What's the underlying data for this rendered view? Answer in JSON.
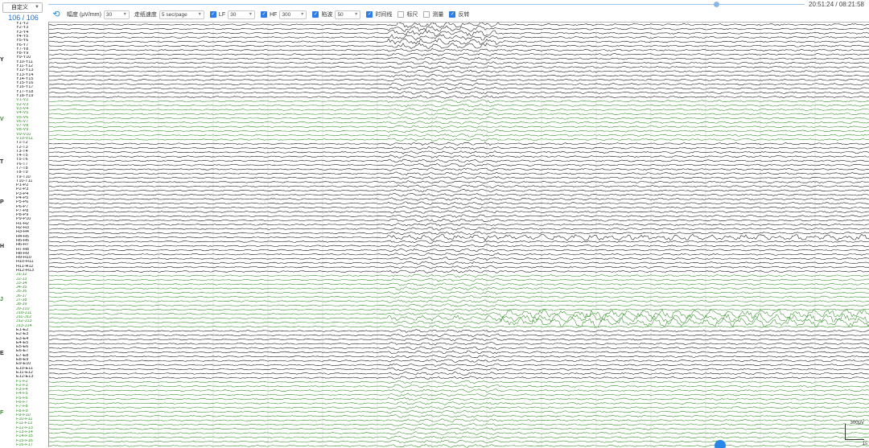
{
  "montage": {
    "value": "自定义"
  },
  "channel_count": "106 / 106",
  "time_readout": "20:51:24 / 08:21:58",
  "playback_position": 0.883,
  "toolbar": {
    "amplitude_label": "幅度 (μV/mm)",
    "amplitude_value": "30",
    "speed_label": "走纸速度",
    "speed_value": "5 sec/page",
    "lf_label": "LF",
    "lf_value": "30",
    "hf_label": "HF",
    "hf_value": "300",
    "notch_label": "陷波",
    "notch_value": "50",
    "timeline_label": "时间线",
    "ruler_label": "标尺",
    "measure_label": "测量",
    "invert_label": "反转"
  },
  "checkboxes": {
    "lf": true,
    "hf": true,
    "notch": true,
    "timeline": true,
    "ruler": false,
    "measure": false,
    "invert": true
  },
  "scale": {
    "amplitude": "300μV",
    "time": "1s"
  },
  "colors": {
    "black_trace": "#111111",
    "green_trace": "#2f8f22",
    "accent": "#2e7ce6"
  },
  "groups": [
    {
      "letter": "Y",
      "color": "black",
      "labels": [
        "Y1-Y2",
        "Y2-Y3",
        "Y3-Y4",
        "Y4-Y5",
        "Y5-Y6",
        "Y6-Y7",
        "Y7-Y8",
        "Y8-Y9",
        "Y9-Y10",
        "Y10-Y11",
        "Y11-Y12",
        "Y12-Y13",
        "Y13-Y14",
        "Y14-Y15",
        "Y15-Y16",
        "Y16-Y17",
        "Y17-Y18",
        "Y18-Y19"
      ]
    },
    {
      "letter": "V",
      "color": "green",
      "labels": [
        "V1-V2",
        "V2-V3",
        "V3-V4",
        "V4-V5",
        "V5-V6",
        "V6-V7",
        "V7-V8",
        "V8-V9",
        "V9-V10",
        "V10-V11"
      ]
    },
    {
      "letter": "T",
      "color": "black",
      "labels": [
        "T1-T2",
        "T2-T3",
        "T3-T4",
        "T4-T5",
        "T5-T6",
        "T6-T7",
        "T7-T8",
        "T8-T9",
        "T9-T10",
        "T10-T11"
      ]
    },
    {
      "letter": "P",
      "color": "black",
      "labels": [
        "P1-P2",
        "P2-P3",
        "P3-P4",
        "P4-P5",
        "P5-P6",
        "P6-P7",
        "P7-P8",
        "P8-P9",
        "P9-P10"
      ]
    },
    {
      "letter": "H",
      "color": "black",
      "labels": [
        "H1-H2",
        "H2-H3",
        "H3-H4",
        "H4-H5",
        "H5-H6",
        "H6-H7",
        "H7-H8",
        "H8-H9",
        "H9-H10",
        "H10-H11",
        "H11-H12",
        "H12-H13"
      ]
    },
    {
      "letter": "J",
      "color": "green",
      "labels": [
        "J1-J2",
        "J2-J3",
        "J3-J4",
        "J4-J5",
        "J5-J6",
        "J6-J7",
        "J7-J8",
        "J8-J9",
        "J9-J10",
        "J10-J11",
        "J11-J12",
        "J12-J13",
        "J13-J14"
      ]
    },
    {
      "letter": "E",
      "color": "black",
      "labels": [
        "E1-E2",
        "E2-E3",
        "E3-E4",
        "E4-E5",
        "E5-E6",
        "E6-E7",
        "E7-E8",
        "E8-E9",
        "E9-E10",
        "E10-E11",
        "E11-E12",
        "E12-E13"
      ]
    },
    {
      "letter": "F",
      "color": "green",
      "labels": [
        "F1-F2",
        "F2-F3",
        "F3-F4",
        "F4-F5",
        "F5-F6",
        "F6-F7",
        "F7-F8",
        "F8-F9",
        "F9-F10",
        "F10-F11",
        "F11-F12",
        "F12-F13",
        "F13-F14",
        "F14-F15",
        "F15-F16",
        "F16-F17"
      ]
    }
  ]
}
